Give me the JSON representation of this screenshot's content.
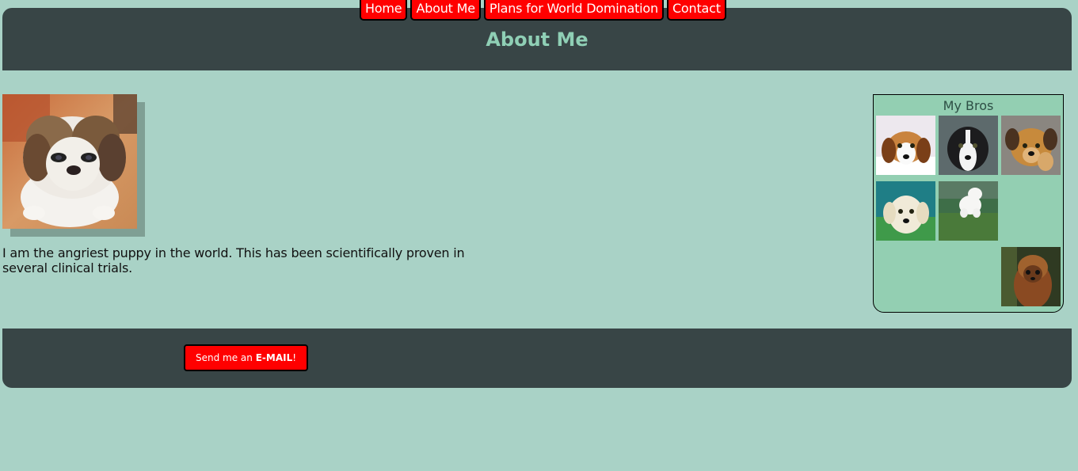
{
  "nav": {
    "items": [
      {
        "label": "Home"
      },
      {
        "label": "About Me"
      },
      {
        "label": "Plans for World Domination"
      },
      {
        "label": "Contact"
      }
    ]
  },
  "header": {
    "title": "About Me"
  },
  "main": {
    "bio": "I am the angriest puppy in the world. This has been scientifically proven in several clinical trials."
  },
  "sidebar": {
    "title": "My Bros"
  },
  "footer": {
    "email_prefix": "Send me an ",
    "email_bold": "E-MAIL",
    "email_suffix": "!"
  },
  "colors": {
    "background": "#a9d2c6",
    "header_bg": "#384546",
    "accent_red": "#ff0000",
    "title_green": "#8fcfb5",
    "sidebar_bg": "#93cfb2"
  }
}
